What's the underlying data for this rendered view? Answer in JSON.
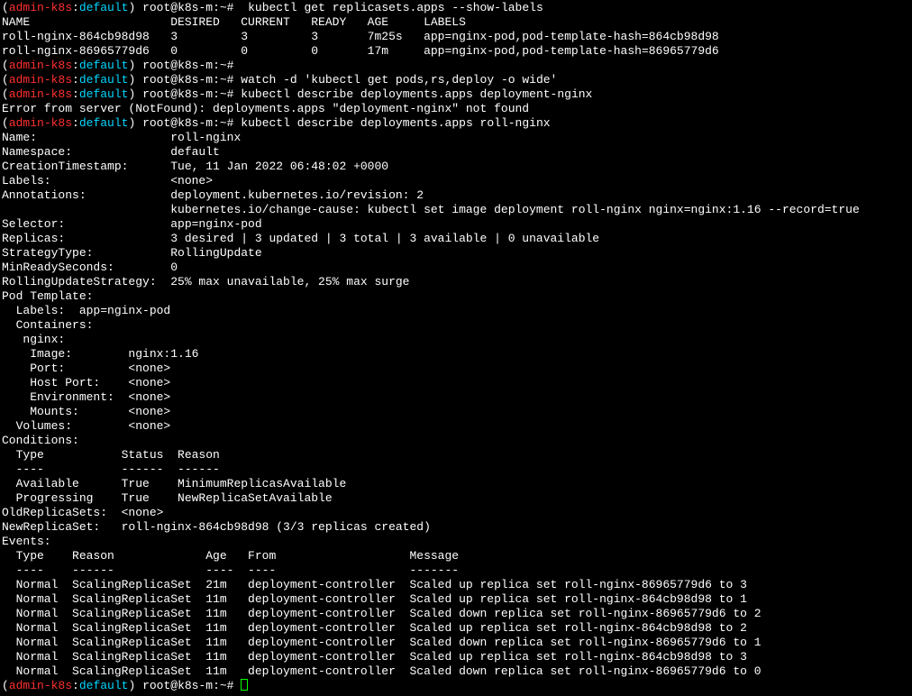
{
  "terminal": {
    "prompt": {
      "open": "(",
      "env": "admin-k8s",
      "sep": ":",
      "namespace": "default",
      "close": ")",
      "userhost": " root@k8s-m:~# "
    },
    "colors": {
      "env": "#ff3030",
      "namespace": "#00d7ff",
      "text": "#ffffff",
      "background": "#000000",
      "cursor": "#00ff00"
    },
    "lines": [
      {
        "type": "prompt",
        "cmd": " kubectl get replicasets.apps --show-labels"
      },
      {
        "type": "output",
        "text": "NAME                    DESIRED   CURRENT   READY   AGE     LABELS"
      },
      {
        "type": "output",
        "text": "roll-nginx-864cb98d98   3         3         3       7m25s   app=nginx-pod,pod-template-hash=864cb98d98"
      },
      {
        "type": "output",
        "text": "roll-nginx-86965779d6   0         0         0       17m     app=nginx-pod,pod-template-hash=86965779d6"
      },
      {
        "type": "prompt",
        "cmd": ""
      },
      {
        "type": "prompt",
        "cmd": "watch -d 'kubectl get pods,rs,deploy -o wide'"
      },
      {
        "type": "prompt",
        "cmd": "kubectl describe deployments.apps deployment-nginx"
      },
      {
        "type": "output",
        "text": "Error from server (NotFound): deployments.apps \"deployment-nginx\" not found"
      },
      {
        "type": "prompt",
        "cmd": "kubectl describe deployments.apps roll-nginx"
      },
      {
        "type": "output",
        "text": "Name:                   roll-nginx"
      },
      {
        "type": "output",
        "text": "Namespace:              default"
      },
      {
        "type": "output",
        "text": "CreationTimestamp:      Tue, 11 Jan 2022 06:48:02 +0000"
      },
      {
        "type": "output",
        "text": "Labels:                 <none>"
      },
      {
        "type": "output",
        "text": "Annotations:            deployment.kubernetes.io/revision: 2"
      },
      {
        "type": "output",
        "text": "                        kubernetes.io/change-cause: kubectl set image deployment roll-nginx nginx=nginx:1.16 --record=true"
      },
      {
        "type": "output",
        "text": "Selector:               app=nginx-pod"
      },
      {
        "type": "output",
        "text": "Replicas:               3 desired | 3 updated | 3 total | 3 available | 0 unavailable"
      },
      {
        "type": "output",
        "text": "StrategyType:           RollingUpdate"
      },
      {
        "type": "output",
        "text": "MinReadySeconds:        0"
      },
      {
        "type": "output",
        "text": "RollingUpdateStrategy:  25% max unavailable, 25% max surge"
      },
      {
        "type": "output",
        "text": "Pod Template:"
      },
      {
        "type": "output",
        "text": "  Labels:  app=nginx-pod"
      },
      {
        "type": "output",
        "text": "  Containers:"
      },
      {
        "type": "output",
        "text": "   nginx:"
      },
      {
        "type": "output",
        "text": "    Image:        nginx:1.16"
      },
      {
        "type": "output",
        "text": "    Port:         <none>"
      },
      {
        "type": "output",
        "text": "    Host Port:    <none>"
      },
      {
        "type": "output",
        "text": "    Environment:  <none>"
      },
      {
        "type": "output",
        "text": "    Mounts:       <none>"
      },
      {
        "type": "output",
        "text": "  Volumes:        <none>"
      },
      {
        "type": "output",
        "text": "Conditions:"
      },
      {
        "type": "output",
        "text": "  Type           Status  Reason"
      },
      {
        "type": "output",
        "text": "  ----           ------  ------"
      },
      {
        "type": "output",
        "text": "  Available      True    MinimumReplicasAvailable"
      },
      {
        "type": "output",
        "text": "  Progressing    True    NewReplicaSetAvailable"
      },
      {
        "type": "output",
        "text": "OldReplicaSets:  <none>"
      },
      {
        "type": "output",
        "text": "NewReplicaSet:   roll-nginx-864cb98d98 (3/3 replicas created)"
      },
      {
        "type": "output",
        "text": "Events:"
      },
      {
        "type": "output",
        "text": "  Type    Reason             Age   From                   Message"
      },
      {
        "type": "output",
        "text": "  ----    ------             ----  ----                   -------"
      },
      {
        "type": "output",
        "text": "  Normal  ScalingReplicaSet  21m   deployment-controller  Scaled up replica set roll-nginx-86965779d6 to 3"
      },
      {
        "type": "output",
        "text": "  Normal  ScalingReplicaSet  11m   deployment-controller  Scaled up replica set roll-nginx-864cb98d98 to 1"
      },
      {
        "type": "output",
        "text": "  Normal  ScalingReplicaSet  11m   deployment-controller  Scaled down replica set roll-nginx-86965779d6 to 2"
      },
      {
        "type": "output",
        "text": "  Normal  ScalingReplicaSet  11m   deployment-controller  Scaled up replica set roll-nginx-864cb98d98 to 2"
      },
      {
        "type": "output",
        "text": "  Normal  ScalingReplicaSet  11m   deployment-controller  Scaled down replica set roll-nginx-86965779d6 to 1"
      },
      {
        "type": "output",
        "text": "  Normal  ScalingReplicaSet  11m   deployment-controller  Scaled up replica set roll-nginx-864cb98d98 to 3"
      },
      {
        "type": "output",
        "text": "  Normal  ScalingReplicaSet  11m   deployment-controller  Scaled down replica set roll-nginx-86965779d6 to 0"
      },
      {
        "type": "prompt",
        "cmd": "",
        "cursor": true
      }
    ]
  }
}
